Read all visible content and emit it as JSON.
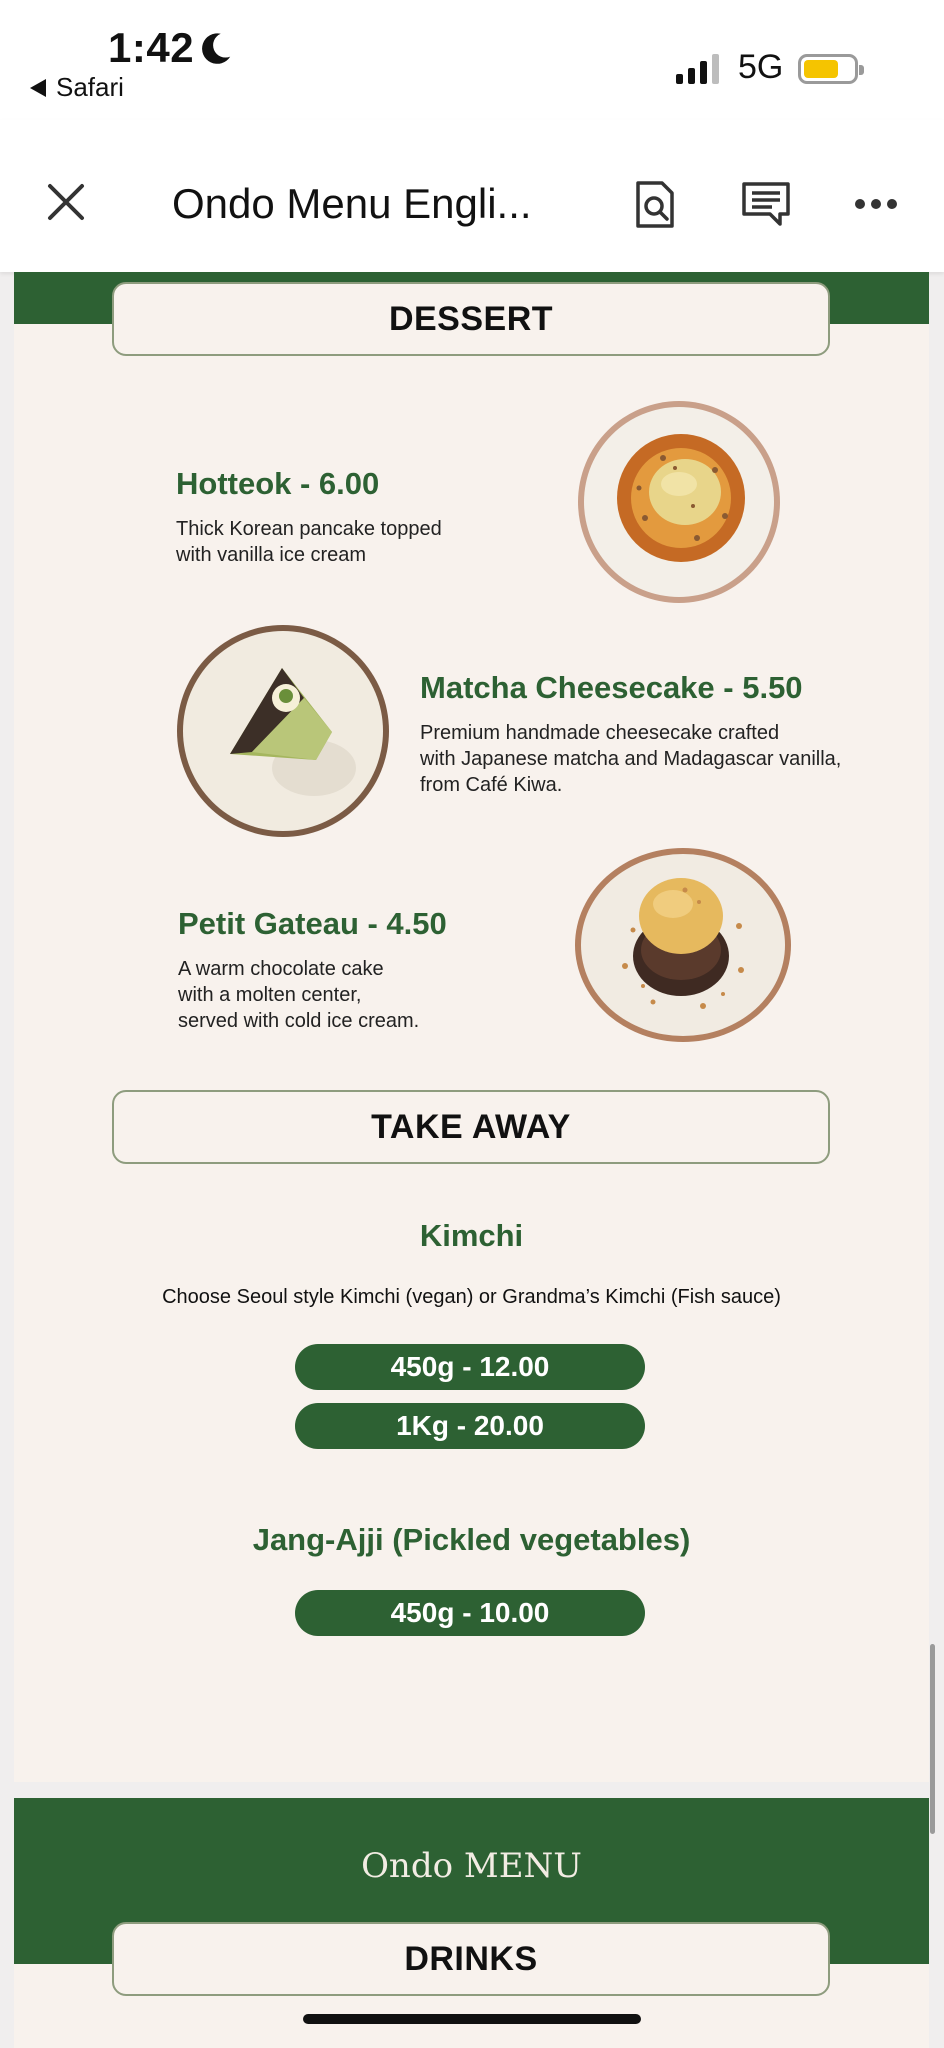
{
  "status_bar": {
    "time": "1:42",
    "back_app": "Safari",
    "network": "5G",
    "battery_level": 0.7
  },
  "toolbar": {
    "title": "Ondo Menu Engli..."
  },
  "dessert": {
    "heading": "DESSERT",
    "items": [
      {
        "name": "Hotteok - 6.00",
        "desc": "Thick Korean pancake topped\nwith vanilla ice cream"
      },
      {
        "name": "Matcha Cheesecake - 5.50",
        "desc": "Premium handmade cheesecake crafted\nwith Japanese matcha and Madagascar vanilla,\nfrom Café Kiwa."
      },
      {
        "name": "Petit Gateau - 4.50",
        "desc": "A warm chocolate cake\nwith a molten center,\nserved with cold ice cream."
      }
    ]
  },
  "takeaway": {
    "heading": "TAKE AWAY",
    "kimchi": {
      "name": "Kimchi",
      "desc": "Choose Seoul style Kimchi (vegan) or Grandma’s Kimchi (Fish sauce)",
      "prices": [
        "450g - 12.00",
        "1Kg - 20.00"
      ]
    },
    "jang": {
      "name": "Jang-Ajji (Pickled vegetables)",
      "prices": [
        "450g - 10.00"
      ]
    }
  },
  "footer": {
    "title": "Ondo MENU",
    "heading": "DRINKS"
  },
  "colors": {
    "brand_green": "#2d6133",
    "cream": "#f8f2ed"
  }
}
